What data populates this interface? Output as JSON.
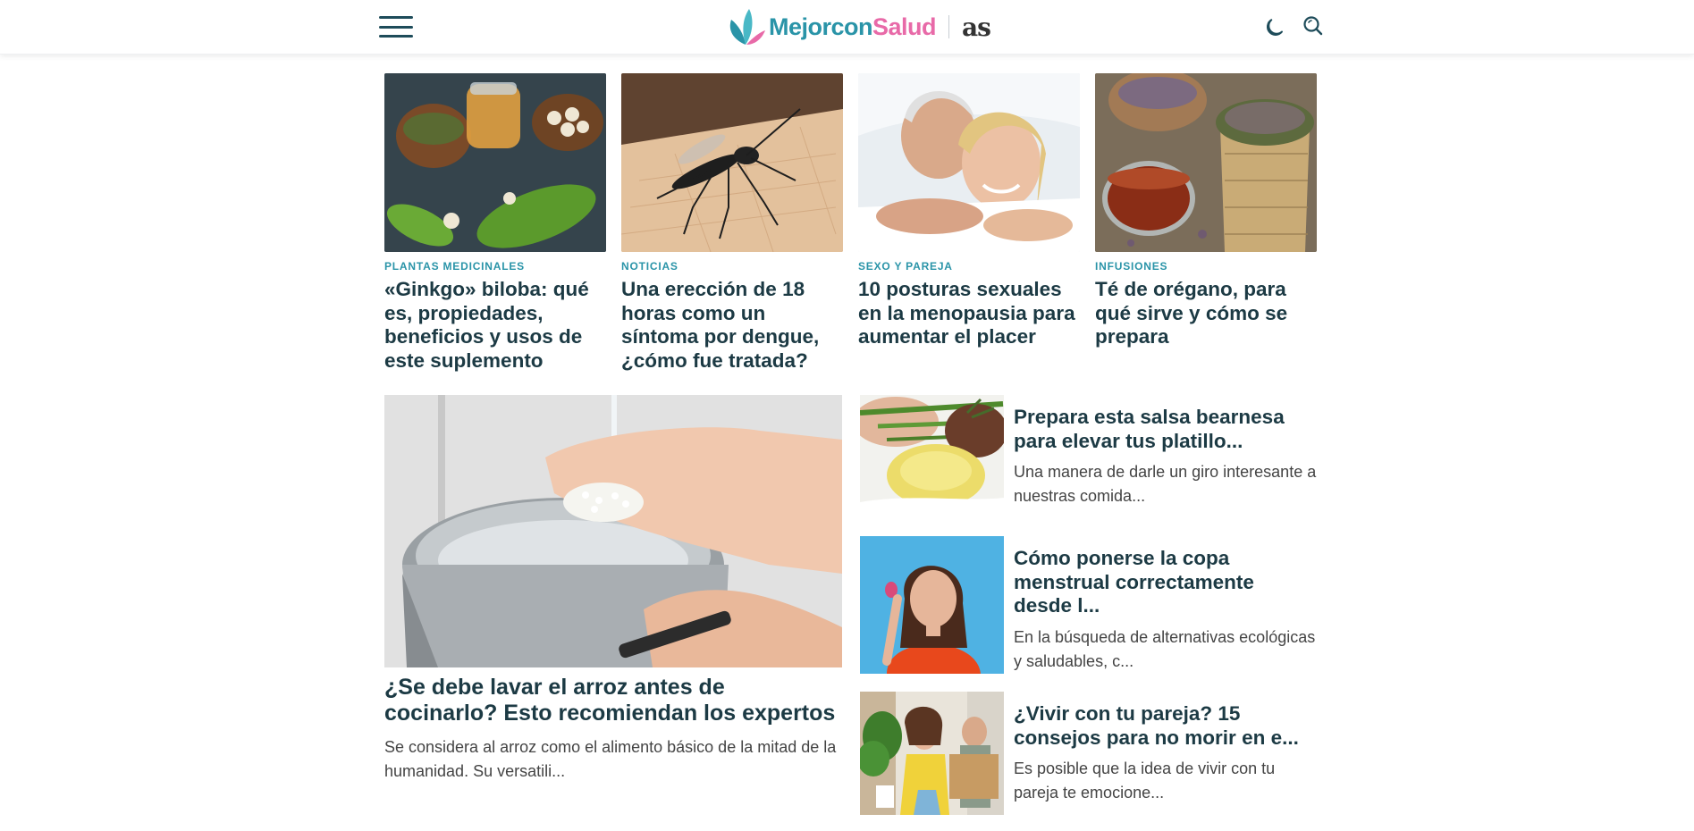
{
  "header": {
    "logo_part1": "Mejorcon",
    "logo_part2": "Salud",
    "partner_logo": "as",
    "icons": [
      "menu-icon",
      "moon-icon",
      "search-icon"
    ]
  },
  "top_articles": [
    {
      "category": "Plantas medicinales",
      "title": "«Ginkgo» biloba: qué es, propiedades, beneficios y usos de este suplemento"
    },
    {
      "category": "Noticias",
      "title": "Una erección de 18 horas como un síntoma por dengue, ¿cómo fue tratada?"
    },
    {
      "category": "Sexo y pareja",
      "title": "10 posturas sexuales en la menopausia para aumentar el placer"
    },
    {
      "category": "Infusiones",
      "title": "Té de orégano, para qué sirve y cómo se prepara"
    }
  ],
  "feature": {
    "title": "¿Se debe lavar el arroz antes de cocinarlo? Esto recomiendan los expertos",
    "description": "Se considera al arroz como el alimento básico de la mitad de la humanidad. Su versatili..."
  },
  "side_articles": [
    {
      "title": "Prepara esta salsa bearnesa para elevar tus platillo...",
      "description": "Una manera de darle un giro interesante a nuestras comida..."
    },
    {
      "title": "Cómo ponerse la copa menstrual correctamente desde l...",
      "description": "En la búsqueda de alternativas ecológicas y saludables, c..."
    },
    {
      "title": "¿Vivir con tu pareja? 15 consejos para no morir en e...",
      "description": "Es posible que la idea de vivir con tu pareja te emocione..."
    }
  ],
  "colors": {
    "accent": "#2a94a8",
    "brand_pink": "#e86aa8",
    "title": "#1c3a44"
  }
}
